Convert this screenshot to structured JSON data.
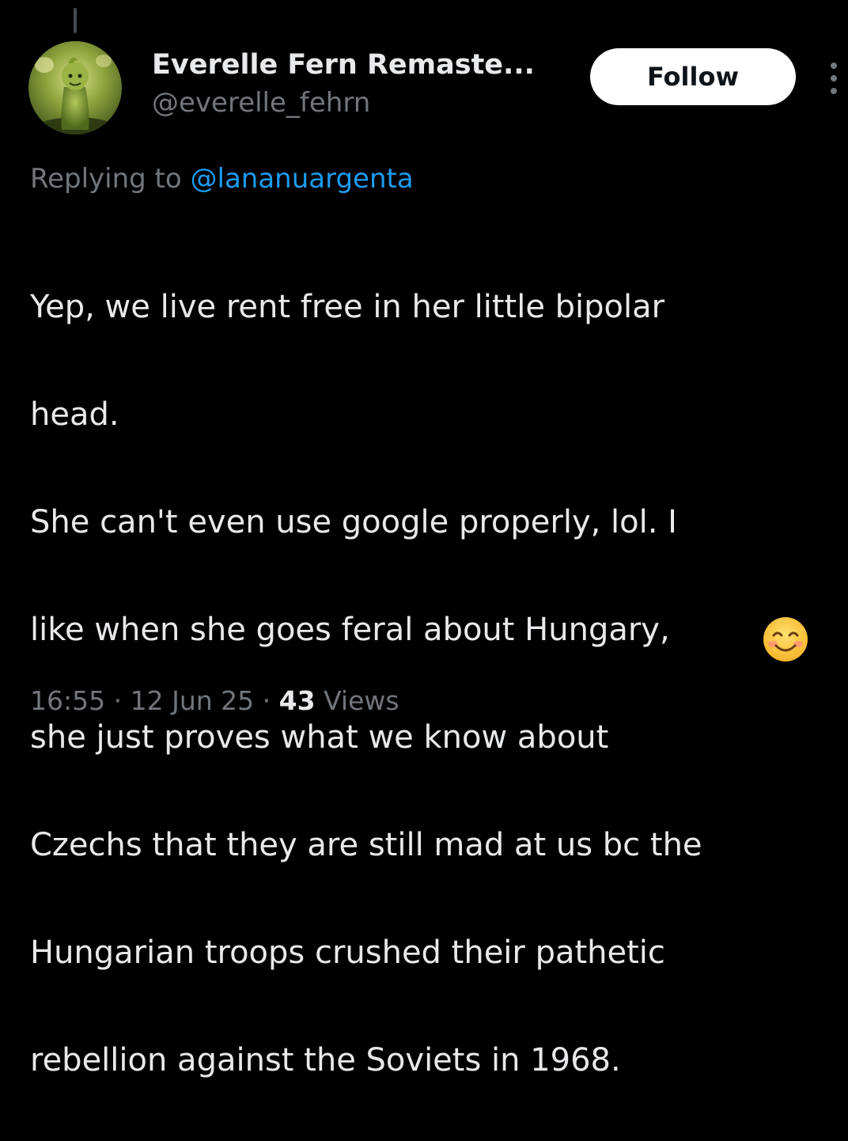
{
  "author": {
    "display_name": "Everelle Fern Remaste...",
    "handle": "@everelle_fehrn",
    "avatar_description": "avatar-image"
  },
  "follow_button": {
    "label": "Follow"
  },
  "more_menu": {
    "icon": "more-vertical-icon"
  },
  "reply": {
    "prefix": "Replying to",
    "mention": "@lananuargenta"
  },
  "tweet": {
    "lines": [
      "Yep, we live rent free in her little bipolar",
      "head.",
      "She can't even use google properly, lol. I",
      "like when she goes feral about Hungary,",
      "she just proves what we know about",
      "Czechs that they are still mad at us bc the",
      "Hungarian troops crushed their pathetic",
      "rebellion against the Soviets in 1968."
    ],
    "emoji": "smiling-face-icon"
  },
  "meta": {
    "time": "16:55",
    "date": "12 Jun 25",
    "separator": "·",
    "views_count": "43",
    "views_label": "Views"
  },
  "colors": {
    "background": "#000000",
    "primary_text": "#e7e9ea",
    "secondary_text": "#71767b",
    "link": "#1d9bf0",
    "follow_bg": "#ffffff"
  }
}
